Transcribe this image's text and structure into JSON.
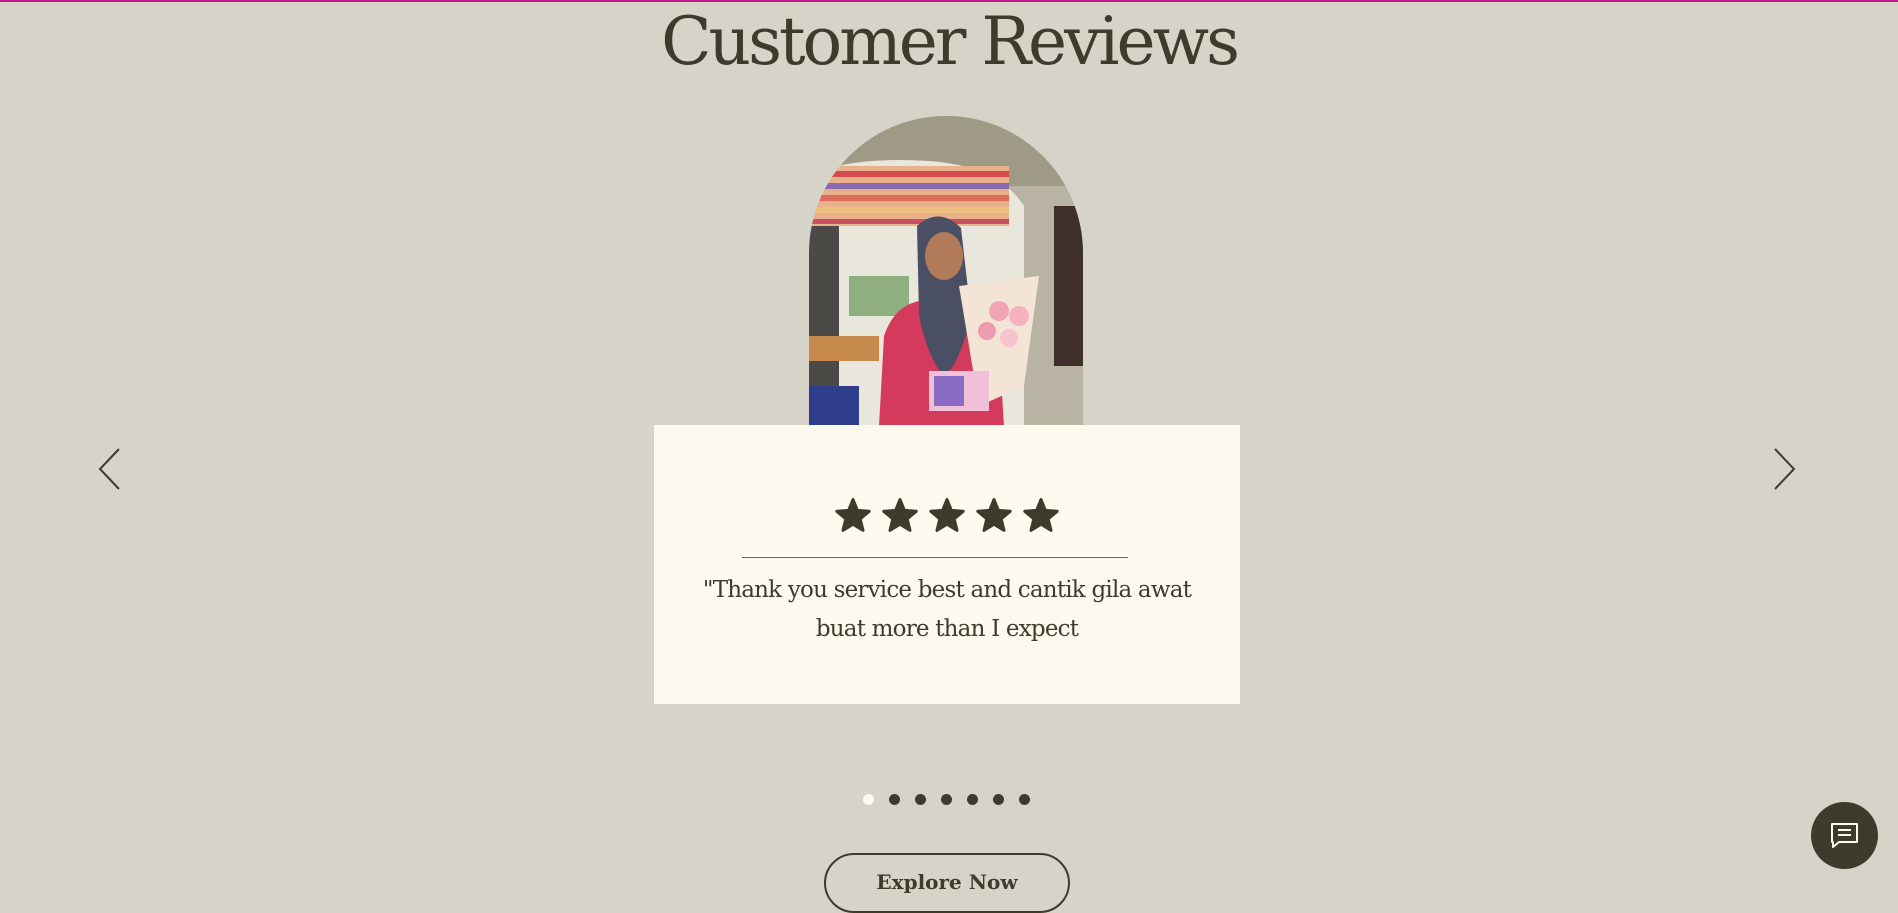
{
  "page": {
    "title": "Customer Reviews",
    "accent_color": "#c2188f",
    "background_color": "#d6d4c8",
    "text_color": "#3d3b2d",
    "card_color": "#fcf9ee"
  },
  "carousel": {
    "prev_icon": "chevron-left-icon",
    "next_icon": "chevron-right-icon",
    "slide_count": 7,
    "active_index": 0,
    "review": {
      "rating": 5,
      "max_rating": 5,
      "star_icon": "star-icon",
      "text": "\"Thank you service best and cantik gila awat buat more than I expect"
    },
    "photo": {
      "icon": "customer-photo"
    }
  },
  "cta": {
    "label": "Explore Now"
  },
  "chat": {
    "icon": "chat-icon"
  }
}
